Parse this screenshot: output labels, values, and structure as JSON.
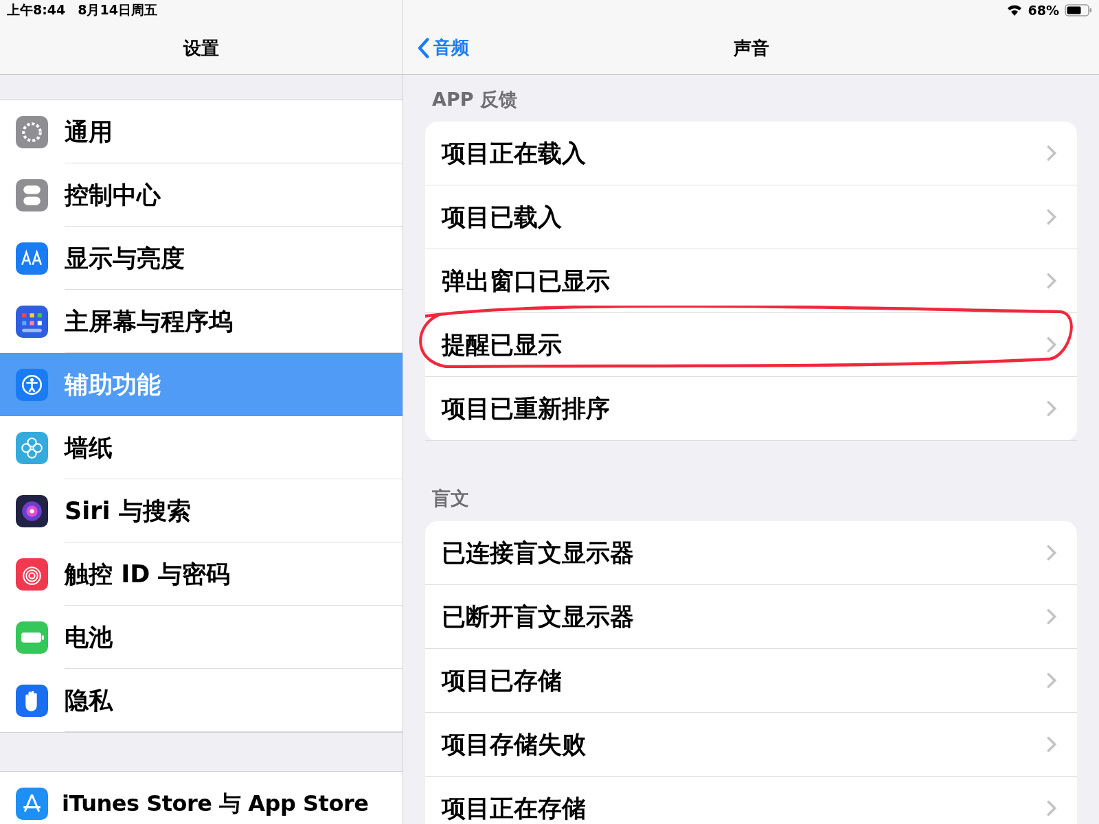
{
  "status_bar": {
    "time": "上午8:44",
    "date": "8月14日周五",
    "battery": "68%"
  },
  "sidebar": {
    "title": "设置",
    "groups": [
      [
        {
          "label": "通用",
          "color": "#8e8e93",
          "selected": false
        },
        {
          "label": "控制中心",
          "color": "#8e8e93",
          "selected": false
        },
        {
          "label": "显示与亮度",
          "color": "#1a7cf5",
          "selected": false
        },
        {
          "label": "主屏幕与程序坞",
          "color": "#2f5ee0",
          "selected": false
        },
        {
          "label": "辅助功能",
          "color": "#1a7cf5",
          "selected": true
        },
        {
          "label": "墙纸",
          "color": "#35aadc",
          "selected": false
        },
        {
          "label": "Siri 与搜索",
          "color": "#222244",
          "selected": false
        },
        {
          "label": "触控 ID 与密码",
          "color": "#f0394f",
          "selected": false
        },
        {
          "label": "电池",
          "color": "#34c759",
          "selected": false
        },
        {
          "label": "隐私",
          "color": "#1a6ef0",
          "selected": false
        }
      ],
      [
        {
          "label": "iTunes Store 与 App Store",
          "color": "#1e8ff5",
          "selected": false
        }
      ]
    ]
  },
  "detail": {
    "back": "音频",
    "title": "声音",
    "sections": [
      {
        "header": "APP 反馈",
        "rows": [
          {
            "label": "项目正在载入",
            "circled": false
          },
          {
            "label": "项目已载入",
            "circled": false
          },
          {
            "label": "弹出窗口已显示",
            "circled": false
          },
          {
            "label": "提醒已显示",
            "circled": true
          },
          {
            "label": "项目已重新排序",
            "circled": false
          }
        ]
      },
      {
        "header": "盲文",
        "rows": [
          {
            "label": "已连接盲文显示器",
            "circled": false
          },
          {
            "label": "已断开盲文显示器",
            "circled": false
          },
          {
            "label": "项目已存储",
            "circled": false
          },
          {
            "label": "项目存储失败",
            "circled": false
          },
          {
            "label": "项目正在存储",
            "circled": false
          }
        ]
      }
    ]
  }
}
